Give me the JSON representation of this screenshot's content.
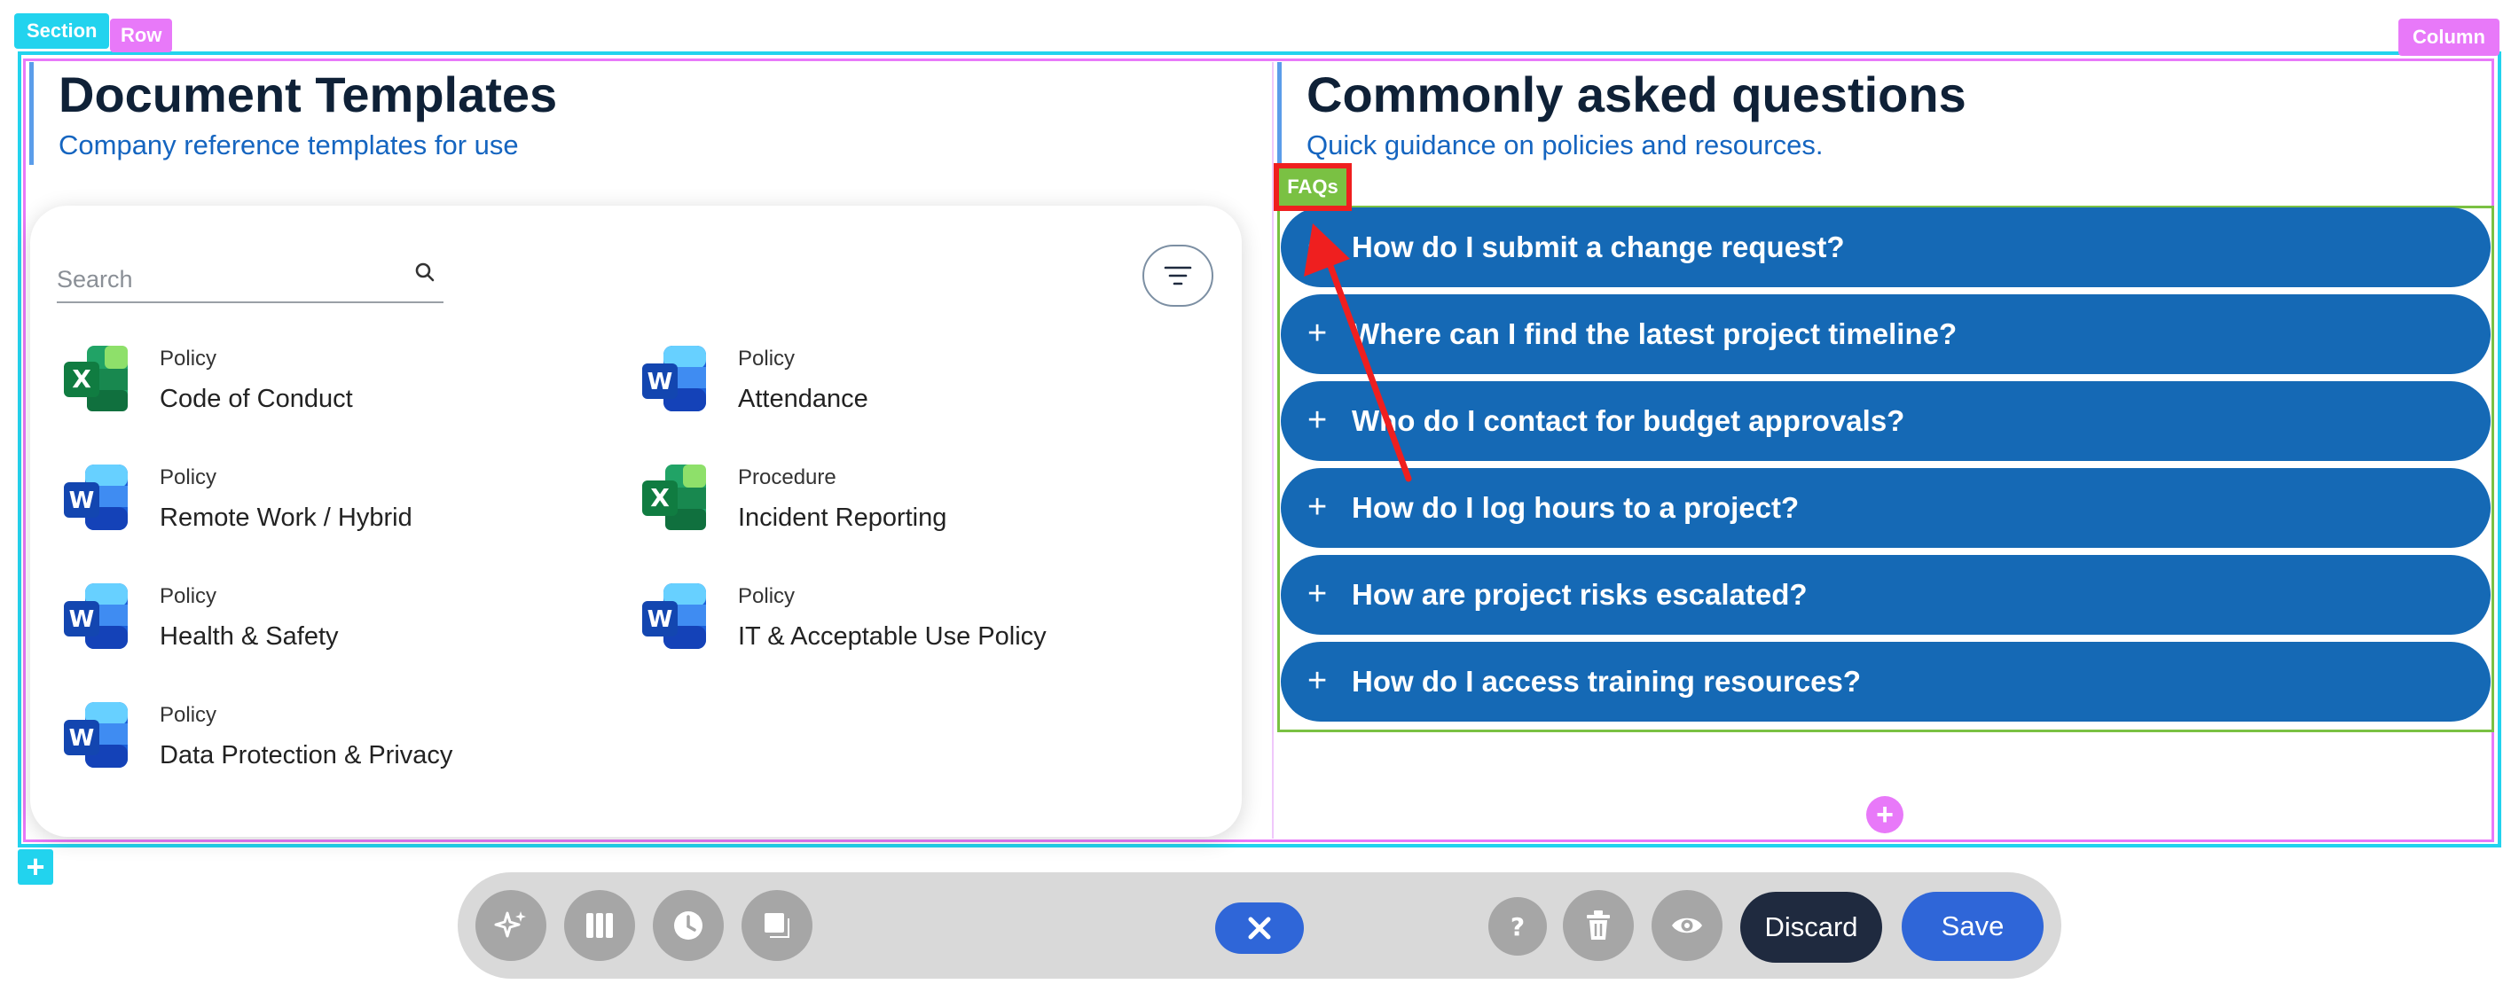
{
  "builder": {
    "section_tag": "Section",
    "row_tag": "Row",
    "column_tag": "Column",
    "faq_tag": "FAQs",
    "add_section": "+",
    "add_row": "+"
  },
  "left_column": {
    "title": "Document Templates",
    "subtitle": "Company reference templates for use",
    "search": {
      "placeholder": "Search",
      "value": ""
    },
    "templates": [
      {
        "category": "Policy",
        "name": "Code of Conduct",
        "icon": "excel-icon"
      },
      {
        "category": "Policy",
        "name": "Attendance",
        "icon": "word-icon"
      },
      {
        "category": "Policy",
        "name": "Remote Work / Hybrid",
        "icon": "word-icon"
      },
      {
        "category": "Procedure",
        "name": "Incident Reporting",
        "icon": "excel-icon"
      },
      {
        "category": "Policy",
        "name": "Health & Safety",
        "icon": "word-icon"
      },
      {
        "category": "Policy",
        "name": "IT & Acceptable Use Policy",
        "icon": "word-icon"
      },
      {
        "category": "Policy",
        "name": "Data Protection & Privacy",
        "icon": "word-icon"
      }
    ]
  },
  "right_column": {
    "title": "Commonly asked questions",
    "subtitle": "Quick guidance on policies and resources.",
    "faqs": [
      {
        "plus": "+",
        "question": "How do I submit a change request?"
      },
      {
        "plus": "+",
        "question": "Where can I find the latest project timeline?"
      },
      {
        "plus": "+",
        "question": "Who do I contact for budget approvals?"
      },
      {
        "plus": "+",
        "question": "How do I log hours to a project?"
      },
      {
        "plus": "+",
        "question": "How are project risks escalated?"
      },
      {
        "plus": "+",
        "question": "How do I access training resources?"
      }
    ]
  },
  "toolbar": {
    "discard_label": "Discard",
    "save_label": "Save",
    "icons": [
      "sparkle-icon",
      "columns-icon",
      "clock-icon",
      "layers-icon",
      "close-icon",
      "help-icon",
      "trash-icon",
      "eye-icon"
    ]
  },
  "colors": {
    "section": "#22d3ee",
    "row": "#e879f9",
    "faq_outline": "#7ac143",
    "faq_bg": "#1569b5",
    "primary": "#2f66d8",
    "annotation": "#ef1f1f"
  }
}
